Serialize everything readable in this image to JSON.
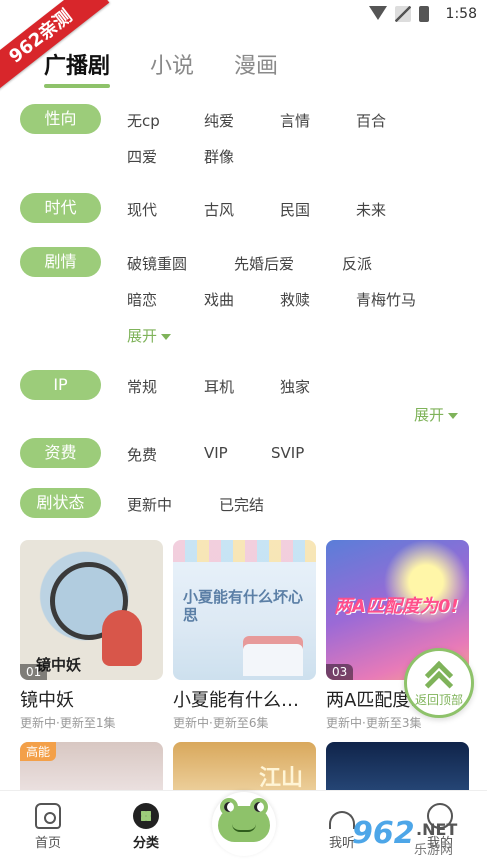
{
  "status_bar": {
    "time": "1:58"
  },
  "watermark_ribbon": "962亲测",
  "top_tabs": [
    {
      "label": "广播剧",
      "active": true
    },
    {
      "label": "小说",
      "active": false
    },
    {
      "label": "漫画",
      "active": false
    }
  ],
  "filters": {
    "xingxiang": {
      "label": "性向",
      "options": [
        "无cp",
        "纯爱",
        "言情",
        "百合",
        "四爱",
        "群像"
      ]
    },
    "shidai": {
      "label": "时代",
      "options": [
        "现代",
        "古风",
        "民国",
        "未来"
      ]
    },
    "juqing": {
      "label": "剧情",
      "options": [
        "破镜重圆",
        "先婚后爱",
        "反派",
        "暗恋",
        "戏曲",
        "救赎",
        "青梅竹马"
      ],
      "expand": "展开"
    },
    "ip": {
      "label": "IP",
      "options": [
        "常规",
        "耳机",
        "独家"
      ],
      "expand": "展开"
    },
    "zifei": {
      "label": "资费",
      "options": [
        "免费",
        "VIP",
        "SVIP"
      ]
    },
    "juzhuangtai": {
      "label": "剧状态",
      "options": [
        "更新中",
        "已完结"
      ]
    }
  },
  "cards": [
    {
      "title": "镜中妖",
      "subtitle": "更新中·更新至1集",
      "badge": "01",
      "cover_text": "镜中妖"
    },
    {
      "title": "小夏能有什么坏...",
      "subtitle": "更新中·更新至6集",
      "badge": "",
      "cover_text": "小夏能有什么坏心思"
    },
    {
      "title": "两A匹配度...",
      "subtitle": "更新中·更新至3集",
      "badge": "03",
      "cover_text": "两A匹配度为0!"
    }
  ],
  "lower_cards": [
    {
      "badge": "高能",
      "cover_text": ""
    },
    {
      "badge": "",
      "cover_text": "江山"
    },
    {
      "badge": "",
      "cover_text": ""
    }
  ],
  "back_to_top": "返回顶部",
  "bottom_nav": [
    {
      "label": "首页",
      "icon": "home-icon",
      "active": false
    },
    {
      "label": "分类",
      "icon": "category-icon",
      "active": true
    },
    {
      "label": "我听",
      "icon": "listen-icon",
      "active": false
    },
    {
      "label": "我的",
      "icon": "mine-icon",
      "active": false
    }
  ],
  "site_watermark": {
    "num": "962",
    "net": ".NET",
    "cn": "乐游网"
  },
  "colors": {
    "accent": "#9ccc7a",
    "accent_text": "#7fb35a",
    "ribbon": "#d8262b"
  }
}
